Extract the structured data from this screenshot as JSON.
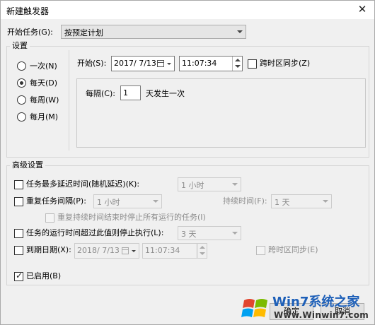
{
  "window": {
    "title": "新建触发器",
    "close_glyph": "✕"
  },
  "start_task": {
    "label": "开始任务(G):",
    "value": "按预定计划"
  },
  "settings": {
    "title": "设置",
    "radios": [
      {
        "label": "一次(N)",
        "checked": false
      },
      {
        "label": "每天(D)",
        "checked": true
      },
      {
        "label": "每周(W)",
        "checked": false
      },
      {
        "label": "每月(M)",
        "checked": false
      }
    ],
    "start_label": "开始(S):",
    "start_date": "2017/ 7/13",
    "start_time": "11:07:34",
    "sync_label": "跨时区同步(Z)",
    "recur_label": "每隔(C):",
    "recur_value": "1",
    "recur_suffix": "天发生一次"
  },
  "advanced": {
    "title": "高级设置",
    "delay_label": "任务最多延迟时间(随机延迟)(K):",
    "delay_value": "1 小时",
    "repeat_label": "重复任务间隔(P):",
    "repeat_value": "1 小时",
    "duration_label": "持续时间(F):",
    "duration_value": "1 天",
    "stop_repeat_label": "重复持续时间结束时停止所有运行的任务(I)",
    "stop_if_label": "任务的运行时间超过此值则停止执行(L):",
    "stop_if_value": "3 天",
    "expire_label": "到期日期(X):",
    "expire_date": "2018/ 7/13",
    "expire_time": "11:07:34",
    "expire_sync_label": "跨时区同步(E)",
    "enabled_label": "已启用(B)",
    "enabled_checked": true
  },
  "buttons": {
    "ok": "确定",
    "cancel": "取消"
  },
  "watermark": {
    "brand": "Win7系统之家",
    "url": "Www.Winwin7.com"
  },
  "colors": {
    "window_bg": "#f0f0f0",
    "border": "#d5d5d5",
    "disabled_text": "#8c8c8c",
    "brand_blue": "#1d5fb8"
  }
}
